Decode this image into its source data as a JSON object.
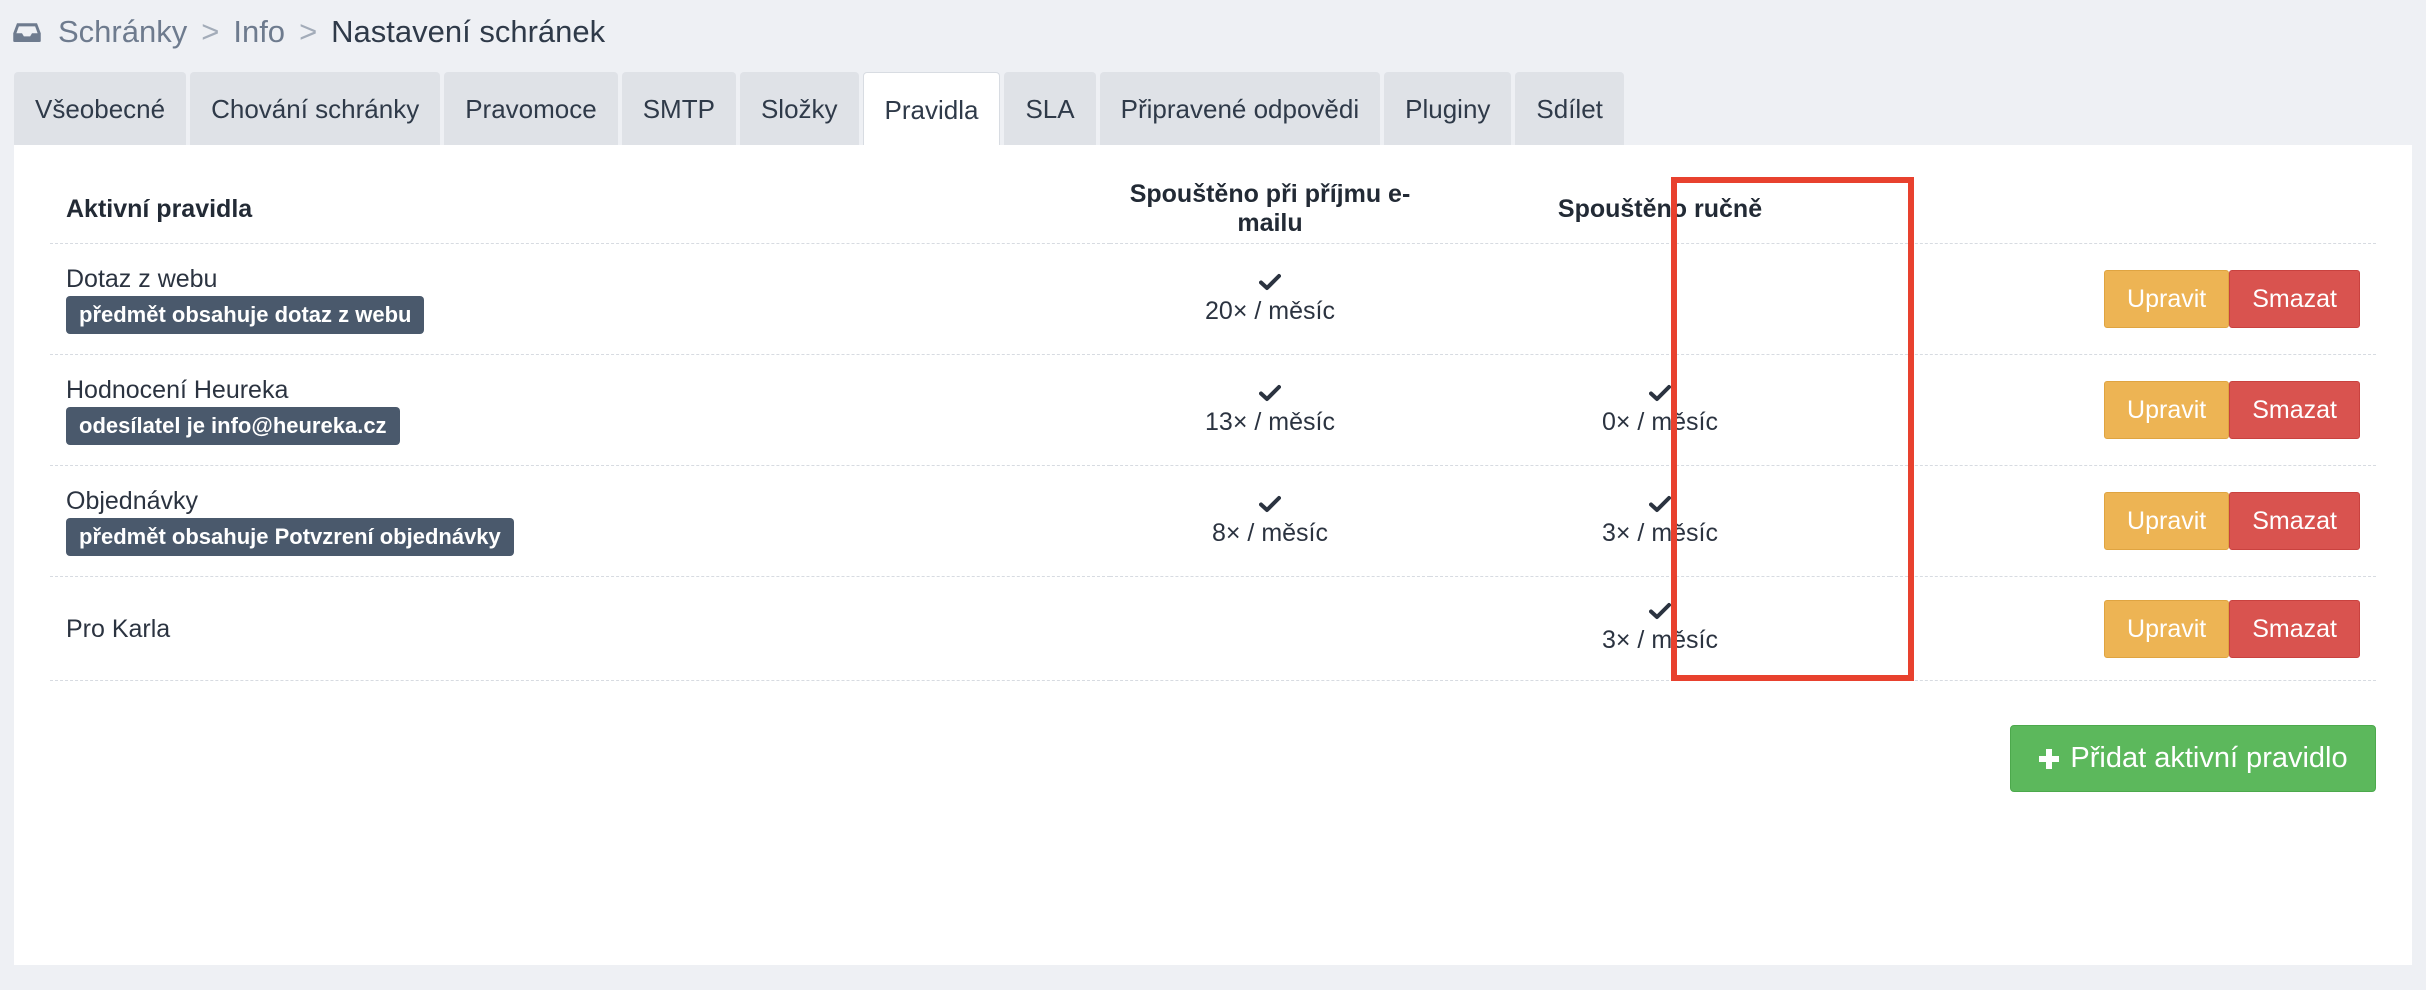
{
  "breadcrumb": {
    "items": [
      "Schránky",
      "Info"
    ],
    "separator": ">",
    "current": "Nastavení schránek",
    "icon": "inbox-icon"
  },
  "tabs": [
    {
      "label": "Všeobecné"
    },
    {
      "label": "Chování schránky"
    },
    {
      "label": "Pravomoce"
    },
    {
      "label": "SMTP"
    },
    {
      "label": "Složky"
    },
    {
      "label": "Pravidla",
      "active": true
    },
    {
      "label": "SLA"
    },
    {
      "label": "Připravené odpovědi"
    },
    {
      "label": "Pluginy"
    },
    {
      "label": "Sdílet"
    }
  ],
  "table": {
    "headers": {
      "name": "Aktivní pravidla",
      "auto": "Spouštěno při příjmu e-mailu",
      "manual": "Spouštěno ručně"
    },
    "rows": [
      {
        "name": "Dotaz z webu",
        "badge": "předmět obsahuje dotaz z webu",
        "auto_count": "20× / měsíc",
        "manual_count": null
      },
      {
        "name": "Hodnocení Heureka",
        "badge": "odesílatel je info@heureka.cz",
        "auto_count": "13× / měsíc",
        "manual_count": "0× / měsíc"
      },
      {
        "name": "Objednávky",
        "badge": "předmět obsahuje Potvzrení objednávky",
        "auto_count": "8× / měsíc",
        "manual_count": "3× / měsíc"
      },
      {
        "name": "Pro Karla",
        "badge": null,
        "auto_count": null,
        "manual_count": "3× / měsíc"
      }
    ],
    "edit_label": "Upravit",
    "delete_label": "Smazat"
  },
  "add_button": {
    "label": "Přidat aktivní pravidlo",
    "icon": "plus-icon"
  },
  "colors": {
    "edit": "#edb454",
    "delete": "#d9534f",
    "add": "#5cb85c",
    "badge": "#4a596c",
    "highlight": "#e8412e"
  }
}
